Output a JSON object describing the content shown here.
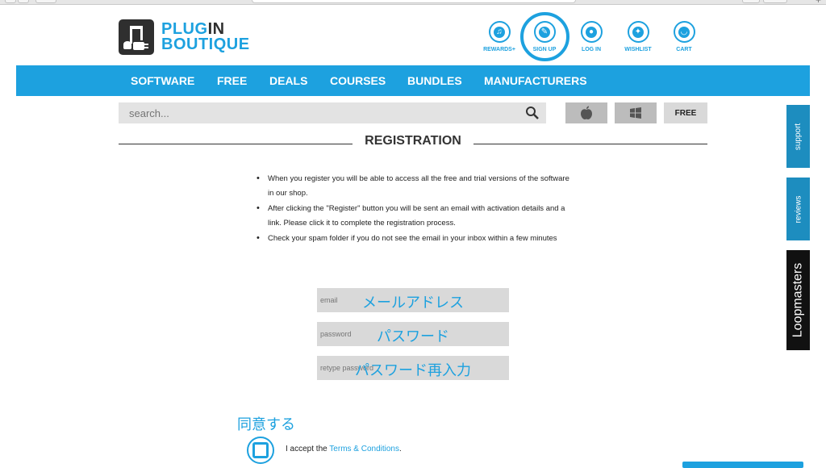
{
  "logo": {
    "line1_a": "PLUG",
    "line1_b": "IN",
    "line2": "BOUTIQUE"
  },
  "top_icons": [
    {
      "label": "REWARDS+",
      "icon": "music-note-icon"
    },
    {
      "label": "SIGN UP",
      "icon": "pencil-icon"
    },
    {
      "label": "LOG IN",
      "icon": "user-icon"
    },
    {
      "label": "WISHLIST",
      "icon": "wand-icon"
    },
    {
      "label": "CART",
      "icon": "basket-icon"
    }
  ],
  "nav": [
    "SOFTWARE",
    "FREE",
    "DEALS",
    "COURSES",
    "BUNDLES",
    "MANUFACTURERS"
  ],
  "search": {
    "placeholder": "search..."
  },
  "platform": {
    "free_label": "FREE"
  },
  "page": {
    "title": "REGISTRATION"
  },
  "bullets": [
    "When you register you will be able to access all the free and trial versions of the software in our shop.",
    "After clicking the \"Register\" button you will be sent an email with activation details and a link. Please click it to complete the registration process.",
    "Check your spam folder if you do not see the email in your inbox within a few minutes"
  ],
  "form": {
    "email_placeholder": "email",
    "password_placeholder": "password",
    "retype_placeholder": "retype password"
  },
  "annotations": {
    "email": "メールアドレス",
    "password": "パスワード",
    "retype": "パスワード再入力",
    "agree": "同意する"
  },
  "terms": {
    "prefix": "I accept the ",
    "link": "Terms & Conditions",
    "suffix": "."
  },
  "side_tabs": {
    "support": "support",
    "reviews": "reviews",
    "loopmasters": "Loopmasters"
  },
  "colors": {
    "brand_blue": "#1da1df",
    "dark": "#2f2f2f"
  }
}
